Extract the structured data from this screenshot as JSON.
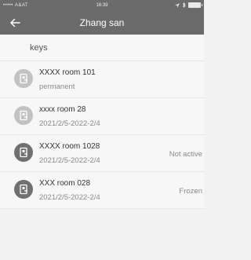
{
  "status_bar": {
    "carrier": "••••• A&AT",
    "time": "16:39"
  },
  "header": {
    "title": "Zhang san",
    "back_icon": "arrow-left-icon"
  },
  "section": {
    "label": "keys"
  },
  "keys": [
    {
      "name": "XXXX room 101",
      "period": "permanent",
      "status": "",
      "icon": "door-lock-icon",
      "icon_color": "#c2c2c2"
    },
    {
      "name": "xxxx room 28",
      "period": "2021/2/5-2022-2/4",
      "status": "",
      "icon": "door-lock-icon",
      "icon_color": "#c2c2c2"
    },
    {
      "name": "XXXX room 1028",
      "period": "2021/2/5-2022-2/4",
      "status": "Not active",
      "icon": "door-lock-icon",
      "icon_color": "#707070"
    },
    {
      "name": "XXX room 028",
      "period": "2021/2/5-2022-2/4",
      "status": "Frozen",
      "icon": "door-lock-icon",
      "icon_color": "#707070"
    }
  ],
  "colors": {
    "header_bg": "#6b6b6b",
    "page_bg": "#f2f2f2",
    "row_bg": "#f7f7f7"
  }
}
